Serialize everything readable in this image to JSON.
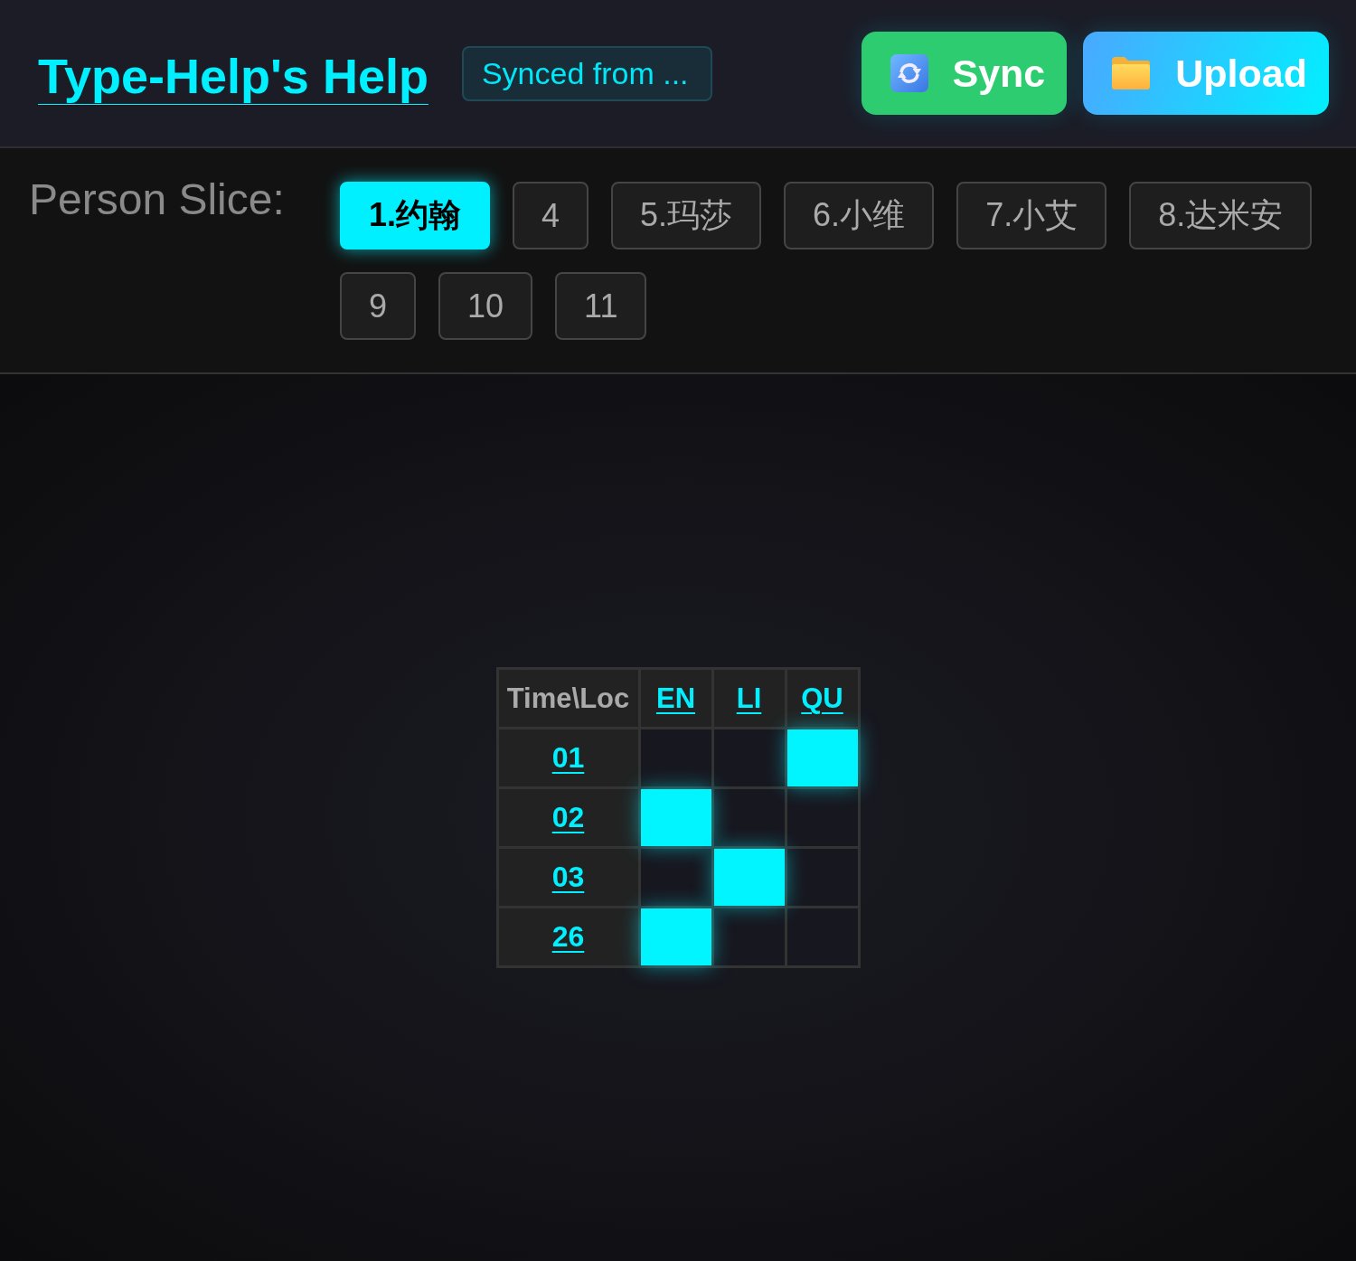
{
  "header": {
    "title": "Type-Help's Help",
    "sync_status": "Synced from ...",
    "buttons": [
      {
        "kind": "sync",
        "label": "Sync"
      },
      {
        "kind": "upload",
        "label": "Upload"
      }
    ]
  },
  "person_slice": {
    "label": "Person Slice:",
    "chips": [
      {
        "label": "1.约翰",
        "selected": true
      },
      {
        "label": "4",
        "selected": false
      },
      {
        "label": "5.玛莎",
        "selected": false
      },
      {
        "label": "6.小维",
        "selected": false
      },
      {
        "label": "7.小艾",
        "selected": false
      },
      {
        "label": "8.达米安",
        "selected": false
      },
      {
        "label": "9",
        "selected": false
      },
      {
        "label": "10",
        "selected": false
      },
      {
        "label": "11",
        "selected": false
      }
    ]
  },
  "table": {
    "corner": "Time\\Loc",
    "columns": [
      "EN",
      "LI",
      "QU"
    ],
    "rows": [
      {
        "label": "01",
        "cells": [
          {
            "filled": false
          },
          {
            "filled": false
          },
          {
            "filled": true
          }
        ]
      },
      {
        "label": "02",
        "cells": [
          {
            "filled": true
          },
          {
            "filled": false
          },
          {
            "filled": false
          }
        ]
      },
      {
        "label": "03",
        "cells": [
          {
            "filled": false
          },
          {
            "filled": true
          },
          {
            "filled": false
          }
        ]
      },
      {
        "label": "26",
        "cells": [
          {
            "filled": true
          },
          {
            "filled": false
          },
          {
            "filled": false
          }
        ]
      }
    ]
  }
}
